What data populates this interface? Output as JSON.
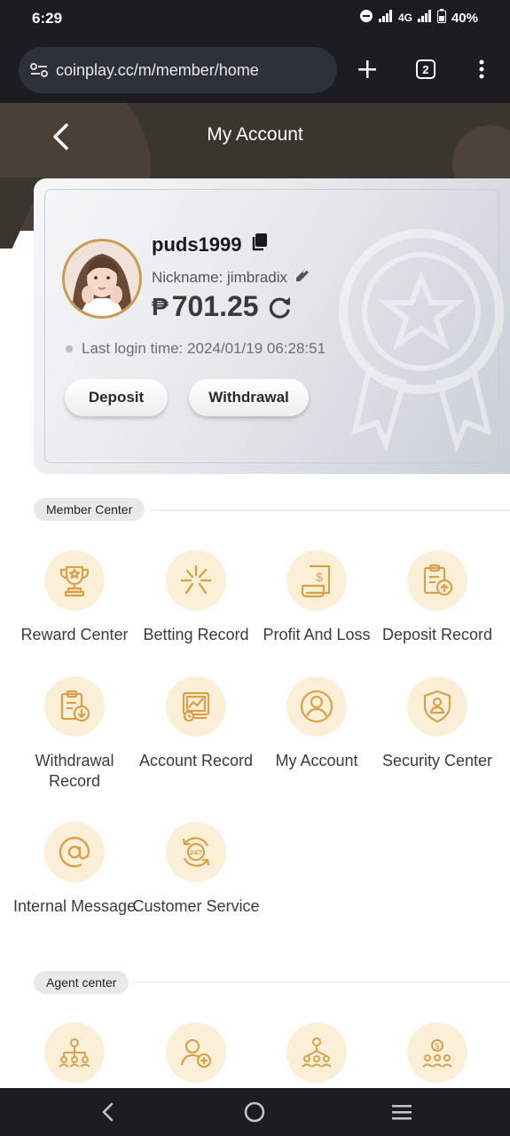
{
  "status_bar": {
    "time": "6:29",
    "network": "4G",
    "battery": "40%"
  },
  "browser": {
    "url": "coinplay.cc/m/member/home",
    "tab_count": "2"
  },
  "header": {
    "title": "My Account"
  },
  "account": {
    "username": "puds1999",
    "nickname": "Nickname: jimbradix",
    "currency": "₱",
    "balance": "701.25",
    "last_login": "Last login time: 2024/01/19 06:28:51",
    "deposit_label": "Deposit",
    "withdrawal_label": "Withdrawal"
  },
  "member_center": {
    "title": "Member Center",
    "items": [
      {
        "label": "Reward Center",
        "icon": "trophy-icon"
      },
      {
        "label": "Betting Record",
        "icon": "sparkle-icon"
      },
      {
        "label": "Profit And Loss",
        "icon": "receipt-dollar-icon"
      },
      {
        "label": "Deposit Record",
        "icon": "clipboard-upload-icon"
      },
      {
        "label": "Withdrawal Record",
        "icon": "clipboard-download-icon"
      },
      {
        "label": "Account Record",
        "icon": "monitor-chart-icon"
      },
      {
        "label": "My Account",
        "icon": "user-circle-icon"
      },
      {
        "label": "Security Center",
        "icon": "shield-user-icon"
      },
      {
        "label": "Internal Message",
        "icon": "at-sign-icon"
      },
      {
        "label": "Customer Service",
        "icon": "support-24-7-icon"
      }
    ]
  },
  "agent_center": {
    "title": "Agent center",
    "items": [
      {
        "icon": "org-chart-icon"
      },
      {
        "icon": "add-user-icon"
      },
      {
        "icon": "team-network-icon"
      },
      {
        "icon": "team-dollar-icon"
      }
    ]
  },
  "colors": {
    "accent": "#d9a14a",
    "icon_bg": "#fcefd8",
    "dark": "#1b1d22"
  }
}
